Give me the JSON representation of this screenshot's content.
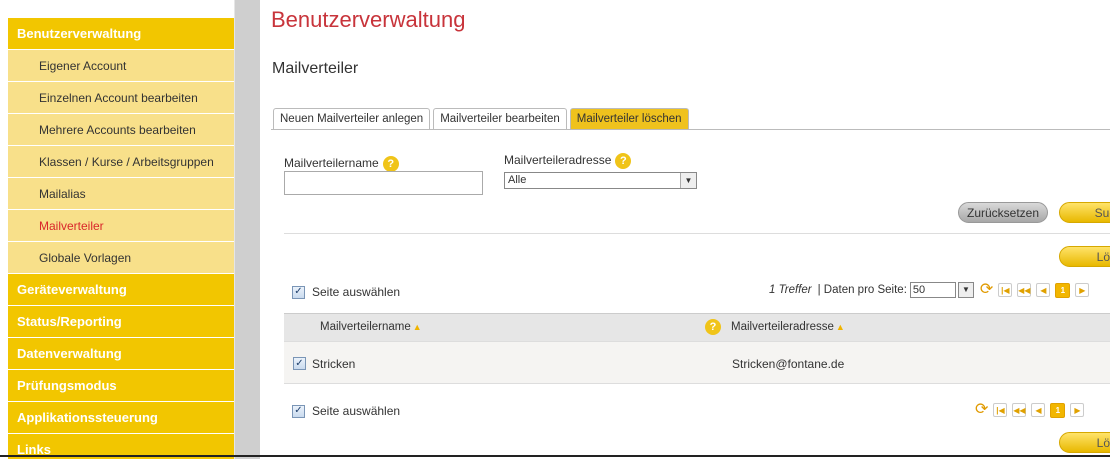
{
  "sidebar": {
    "categories": [
      {
        "label": "Benutzerverwaltung"
      },
      {
        "label": "Geräteverwaltung"
      },
      {
        "label": "Status/Reporting"
      },
      {
        "label": "Datenverwaltung"
      },
      {
        "label": "Prüfungsmodus"
      },
      {
        "label": "Applikationssteuerung"
      },
      {
        "label": "Links"
      }
    ],
    "sub_items": [
      {
        "label": "Eigener Account"
      },
      {
        "label": "Einzelnen Account bearbeiten"
      },
      {
        "label": "Mehrere Accounts bearbeiten"
      },
      {
        "label": "Klassen / Kurse / Arbeitsgruppen"
      },
      {
        "label": "Mailalias"
      },
      {
        "label": "Mailverteiler"
      },
      {
        "label": "Globale Vorlagen"
      }
    ]
  },
  "page": {
    "title": "Benutzerverwaltung",
    "section": "Mailverteiler"
  },
  "tabs": [
    "Neuen Mailverteiler anlegen",
    "Mailverteiler bearbeiten",
    "Mailverteiler löschen"
  ],
  "filter": {
    "name_label": "Mailverteilername",
    "name_value": "",
    "address_label": "Mailverteileradresse",
    "address_value": "Alle",
    "help_glyph": "?",
    "reset_label": "Zurücksetzen",
    "search_label": "Such"
  },
  "actions": {
    "delete_label": "Lösc"
  },
  "list": {
    "select_all": "Seite auswählen",
    "hits": "1 Treffer",
    "per_page_label": "| Daten pro Seite:",
    "per_page_value": "50",
    "current_page": "1",
    "columns": [
      "Mailverteilername",
      "Mailverteileradresse"
    ],
    "rows": [
      {
        "name": "Stricken",
        "address": "Stricken@fontane.de",
        "checked": true
      }
    ]
  },
  "colors": {
    "accent": "#f2c600",
    "title_red": "#c8343b",
    "active_link": "#d9262b"
  }
}
